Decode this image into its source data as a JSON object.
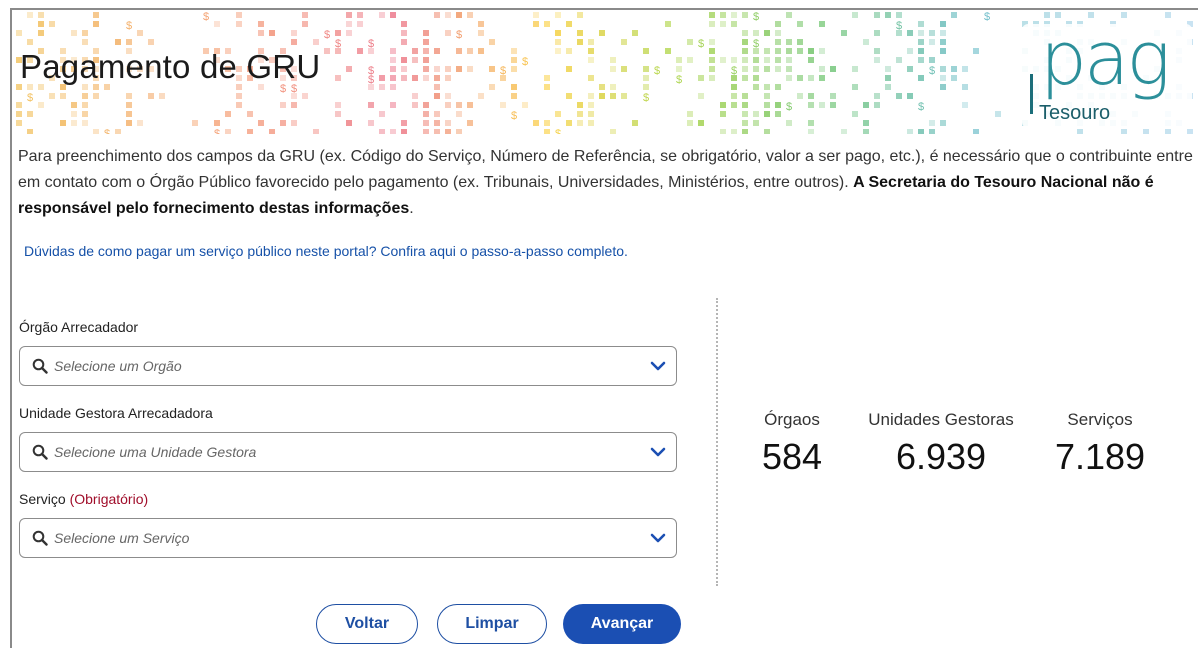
{
  "header": {
    "title": "Pagamento de GRU",
    "logo_word": "pag",
    "logo_sub": "Tesouro"
  },
  "intro": {
    "text_normal": "Para preenchimento dos campos da GRU (ex. Código do Serviço, Número de Referência, se obrigatório, valor a ser pago, etc.), é necessário que o contribuinte entre em contato com o Órgão Público favorecido pelo pagamento (ex. Tribunais, Universidades, Ministérios, entre outros). ",
    "text_bold": "A Secretaria do Tesouro Nacional não é responsável pelo fornecimento destas informações",
    "text_end": "."
  },
  "help_link": "Dúvidas de como pagar um serviço público neste portal? Confira aqui o passo-a-passo completo.",
  "form": {
    "orgao": {
      "label": "Órgão Arrecadador",
      "placeholder": "Selecione um Orgão"
    },
    "unidade": {
      "label": "Unidade Gestora Arrecadadora",
      "placeholder": "Selecione uma Unidade Gestora"
    },
    "servico": {
      "label": "Serviço",
      "required": "(Obrigatório)",
      "placeholder": "Selecione um Serviço"
    }
  },
  "stats": [
    {
      "label": "Órgaos",
      "value": "584"
    },
    {
      "label": "Unidades Gestoras",
      "value": "6.939"
    },
    {
      "label": "Serviços",
      "value": "7.189"
    }
  ],
  "buttons": {
    "back": "Voltar",
    "clear": "Limpar",
    "next": "Avançar"
  },
  "colors": {
    "link": "#1651a8",
    "primary": "#1b4fb3",
    "required": "#a00d2a"
  }
}
